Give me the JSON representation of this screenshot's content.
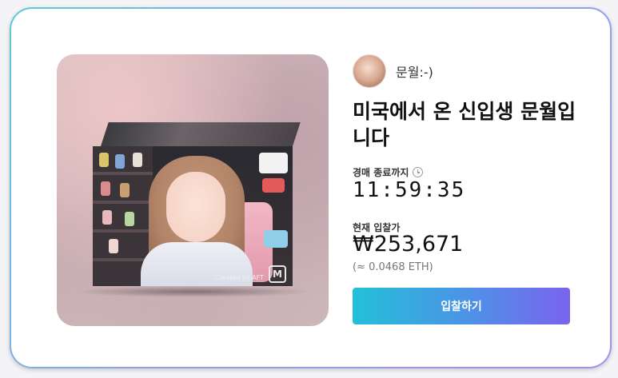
{
  "creator": {
    "name": "문월:-)",
    "avatar_icon": "avatar-photo"
  },
  "item": {
    "title": "미국에서 온 신입생 문월입니다"
  },
  "media": {
    "credit": "Created by AFT",
    "logo_letter": "M"
  },
  "auction": {
    "end_label": "경매 종료까지",
    "countdown": "11:59:35",
    "price_label": "현재 입찰가",
    "price_krw": "₩253,671",
    "price_eth": "(≈ 0.0468 ETH)"
  },
  "actions": {
    "bid_label": "입찰하기"
  },
  "colors": {
    "button_start": "#23c0d8",
    "button_end": "#7a63ee",
    "border_start": "#5ec8dc",
    "border_end": "#a68cf0"
  }
}
